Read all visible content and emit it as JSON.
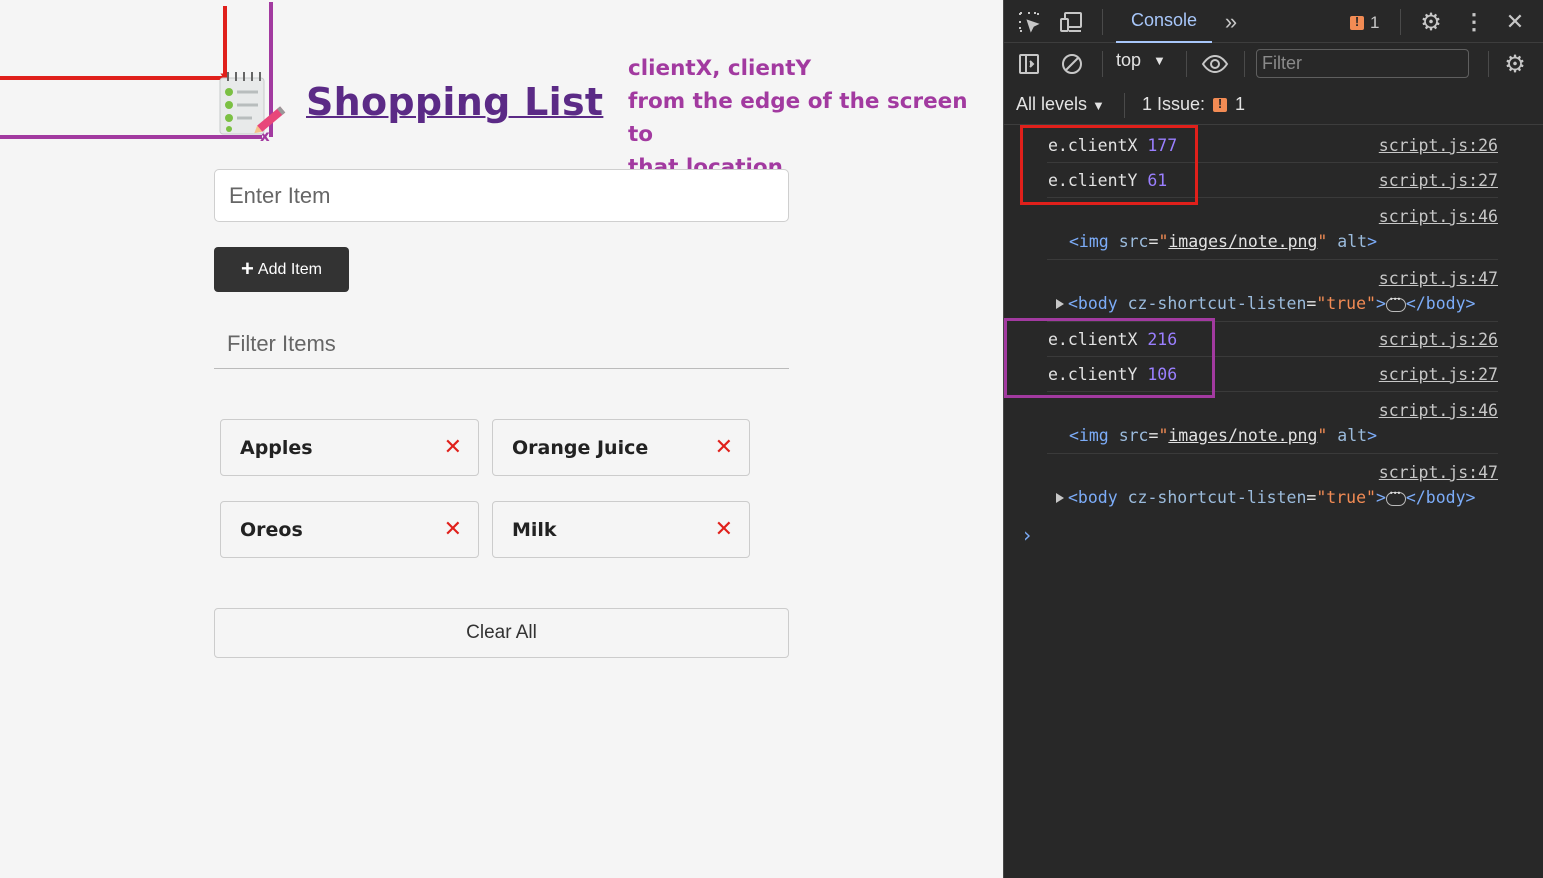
{
  "page": {
    "title": "Shopping List",
    "annotation": [
      "clientX, clientY",
      "from the edge of the screen to",
      "that location"
    ],
    "x_marker": "x",
    "item_input_placeholder": "Enter Item",
    "add_button_label": "Add Item",
    "filter_placeholder": "Filter Items",
    "items": [
      "Apples",
      "Orange Juice",
      "Oreos",
      "Milk"
    ],
    "remove_glyph": "✕",
    "clear_button_label": "Clear All"
  },
  "colors": {
    "annotation_red": "#e0201b",
    "annotation_purple": "#a23aa0",
    "title": "#5b2a86"
  },
  "devtools": {
    "tab": "Console",
    "warning_count": "1",
    "context": "top",
    "filter_placeholder": "Filter",
    "levels": "All levels",
    "issues_label": "1 Issue:",
    "issues_count": "1",
    "logs": [
      {
        "key": "e.clientX",
        "value": "177",
        "source": "script.js:26"
      },
      {
        "key": "e.clientY",
        "value": "61",
        "source": "script.js:27"
      },
      {
        "source": "script.js:46",
        "img_src": "images/note.png"
      },
      {
        "source": "script.js:47",
        "body_attr": "cz-shortcut-listen",
        "body_attr_value": "true"
      },
      {
        "key": "e.clientX",
        "value": "216",
        "source": "script.js:26"
      },
      {
        "key": "e.clientY",
        "value": "106",
        "source": "script.js:27"
      },
      {
        "source": "script.js:46",
        "img_src": "images/note.png"
      },
      {
        "source": "script.js:47",
        "body_attr": "cz-shortcut-listen",
        "body_attr_value": "true"
      }
    ],
    "prompt": "›"
  }
}
